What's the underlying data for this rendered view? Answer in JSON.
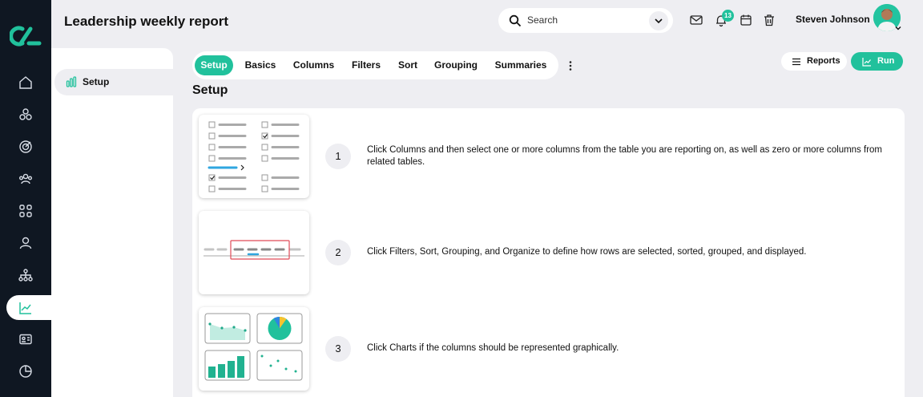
{
  "app": {
    "page_title": "Leadership weekly report"
  },
  "header": {
    "search_placeholder": "Search",
    "notification_count": "13",
    "user_name": "Steven Johnson"
  },
  "subsidebar": {
    "items": [
      {
        "label": "Setup",
        "icon": "bar-chart-icon"
      }
    ]
  },
  "tabs": [
    {
      "label": "Setup",
      "active": true
    },
    {
      "label": "Basics"
    },
    {
      "label": "Columns"
    },
    {
      "label": "Filters"
    },
    {
      "label": "Sort"
    },
    {
      "label": "Grouping"
    },
    {
      "label": "Summaries"
    }
  ],
  "actions": {
    "reports_label": "Reports",
    "run_label": "Run"
  },
  "section": {
    "title": "Setup"
  },
  "steps": [
    {
      "number": "1",
      "text": "Click Columns and then select one or more columns from the table you are reporting on, as well as zero or more columns from related tables."
    },
    {
      "number": "2",
      "text": "Click Filters, Sort, Grouping, and Organize to define how rows are selected, sorted, grouped, and displayed."
    },
    {
      "number": "3",
      "text": "Click Charts if the columns should be represented graphically."
    }
  ],
  "colors": {
    "accent": "#21c19c",
    "rail": "#0f1722",
    "background": "#eeeef2"
  }
}
